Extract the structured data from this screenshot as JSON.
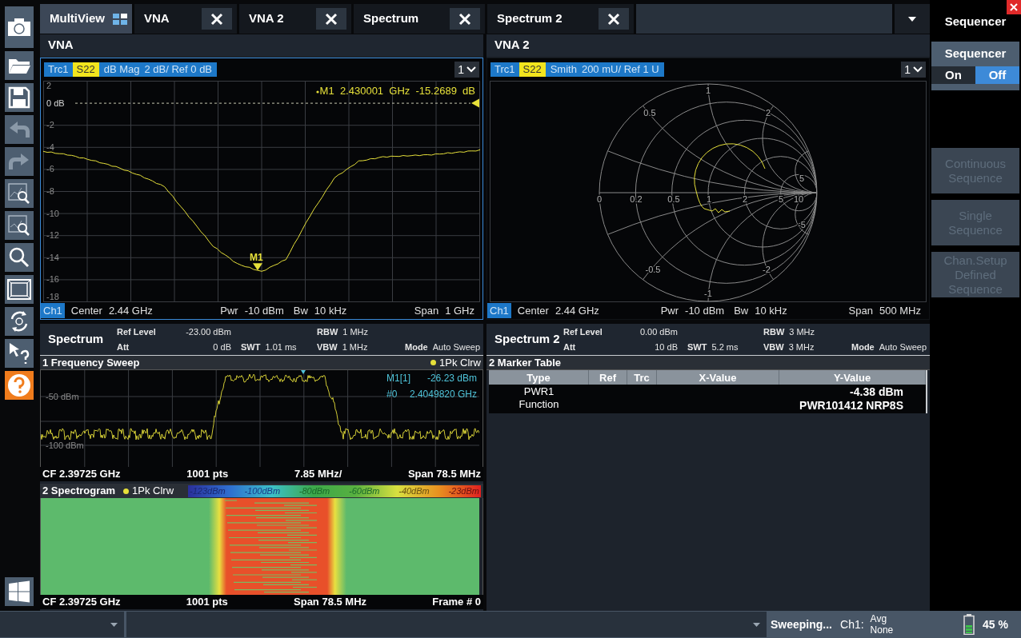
{
  "tabs": [
    {
      "label": "MultiView",
      "selected": true,
      "closable": false
    },
    {
      "label": "VNA",
      "selected": false,
      "closable": true
    },
    {
      "label": "VNA 2",
      "selected": false,
      "closable": true
    },
    {
      "label": "Spectrum",
      "selected": false,
      "closable": true
    },
    {
      "label": "Spectrum 2",
      "selected": false,
      "closable": true
    }
  ],
  "vna": {
    "title": "VNA",
    "trace": {
      "name": "Trc1",
      "parameter": "S22",
      "format": "dB Mag",
      "scale": "2 dB/ Ref 0 dB"
    },
    "channel_selector": "1",
    "marker_readout": "M1  2.430001  GHz  -15.2689  dB",
    "marker_label": "M1",
    "chart_data": {
      "type": "line",
      "grid": true,
      "ref_lines": [
        {
          "axis": "y",
          "value": 0,
          "color": "#c8c8b0"
        }
      ],
      "ylim": [
        -18,
        2
      ],
      "yticks": [
        2,
        {
          "value": 0,
          "label": "0 dB"
        },
        -2,
        -4,
        -6,
        -8,
        -10,
        -12,
        -14,
        -16,
        -18
      ],
      "series": [
        {
          "color": "#e6e03a",
          "values": [
            -4.4,
            -4.7,
            -5.2,
            -5.8,
            -6.6,
            -7.6,
            -10.3,
            -13,
            -14.6,
            -15.3,
            -14.2,
            -10.2,
            -6.8,
            -5.3,
            -4.9,
            -4.8,
            -4.7,
            -4.5,
            -4.3
          ]
        }
      ]
    },
    "footer": {
      "channel": "Ch1",
      "groups": [
        [
          {
            "label": "Center",
            "value": "2.44 GHz"
          }
        ],
        [
          {
            "label": "Pwr",
            "value": "-10 dBm"
          },
          {
            "label": "Bw",
            "value": "10 kHz"
          }
        ],
        [
          {
            "label": "Span",
            "value": "1 GHz"
          }
        ]
      ]
    }
  },
  "vna2": {
    "title": "VNA 2",
    "trace": {
      "name": "Trc1",
      "parameter": "S22",
      "format": "Smith",
      "scale": "200 mU/ Ref 1 U"
    },
    "channel_selector": "1",
    "smith_labels": [
      "1",
      "0.5",
      "2",
      "5",
      "0",
      "0.2",
      "0.5",
      "1",
      "2",
      "5",
      "10",
      "-5",
      "-0.5",
      "-2",
      "-1"
    ],
    "footer": {
      "channel": "Ch1",
      "groups": [
        [
          {
            "label": "Center",
            "value": "2.44 GHz"
          }
        ],
        [
          {
            "label": "Pwr",
            "value": "-10 dBm"
          },
          {
            "label": "Bw",
            "value": "10 kHz"
          }
        ],
        [
          {
            "label": "Span",
            "value": "500 MHz"
          }
        ]
      ]
    }
  },
  "spectrum": {
    "title": "Spectrum",
    "settings": [
      {
        "top": {
          "label": "Ref Level",
          "value": "-23.00 dBm"
        },
        "bottom": {
          "label": "Att",
          "value": "0 dB"
        }
      },
      {
        "bottom": {
          "label": "SWT",
          "value": "1.01 ms"
        }
      },
      {
        "top": {
          "label": "RBW",
          "value": "1 MHz"
        },
        "bottom": {
          "label": "VBW",
          "value": "1 MHz"
        }
      },
      {
        "bottom": {
          "label": "Mode",
          "value": "Auto Sweep"
        }
      }
    ],
    "sweep": {
      "title": "1 Frequency Sweep",
      "trace": "1Pk Clrw",
      "y_labels": [
        "-50 dBm",
        "-100 dBm"
      ],
      "marker_readout": [
        {
          "label": "M1[1]",
          "value": "-26.23 dBm"
        },
        {
          "label": "#0",
          "value": "2.4049820 GHz"
        }
      ],
      "footer": [
        "CF 2.39725 GHz",
        "1001 pts",
        "7.85 MHz/",
        "Span 78.5 MHz"
      ]
    },
    "spectrogram": {
      "title": "2 Spectrogram",
      "trace": "1Pk Clrw",
      "color_scale": [
        "-123dBm",
        "-100dBm",
        "-80dBm",
        "-60dBm",
        "-40dBm",
        "-23dBm"
      ],
      "footer": [
        "CF 2.39725 GHz",
        "1001 pts",
        "Span 78.5 MHz",
        "Frame # 0"
      ]
    }
  },
  "spectrum2": {
    "title": "Spectrum 2",
    "settings": [
      {
        "top": {
          "label": "Ref Level",
          "value": "0.00 dBm"
        },
        "bottom": {
          "label": "Att",
          "value": "10 dB"
        }
      },
      {
        "bottom": {
          "label": "SWT",
          "value": "5.2 ms"
        }
      },
      {
        "top": {
          "label": "RBW",
          "value": "3 MHz"
        },
        "bottom": {
          "label": "VBW",
          "value": "3 MHz"
        }
      },
      {
        "bottom": {
          "label": "Mode",
          "value": "Auto Sweep"
        }
      }
    ],
    "marker_table": {
      "title": "2 Marker Table",
      "columns": [
        "Type",
        "Ref",
        "Trc",
        "X-Value",
        "Y-Value"
      ],
      "rows": [
        {
          "type": [
            "PWR1",
            "Function"
          ],
          "y_value": [
            "-4.38 dBm",
            "PWR101412 NRP8S"
          ]
        }
      ]
    }
  },
  "sequencer": {
    "title": "Sequencer",
    "toggle": {
      "label": "Sequencer",
      "options": [
        {
          "label": "On",
          "selected": false
        },
        {
          "label": "Off",
          "selected": true
        }
      ]
    },
    "buttons": [
      {
        "label": "Continuous Sequence",
        "disabled": true
      },
      {
        "label": "Single Sequence",
        "disabled": true
      },
      {
        "label": "Chan.Setup Defined Sequence",
        "disabled": true
      }
    ]
  },
  "status_bar": {
    "message": "Sweeping...",
    "channel": "Ch1:",
    "avg_label": "Avg",
    "avg_value": "None",
    "battery": "45 %"
  }
}
